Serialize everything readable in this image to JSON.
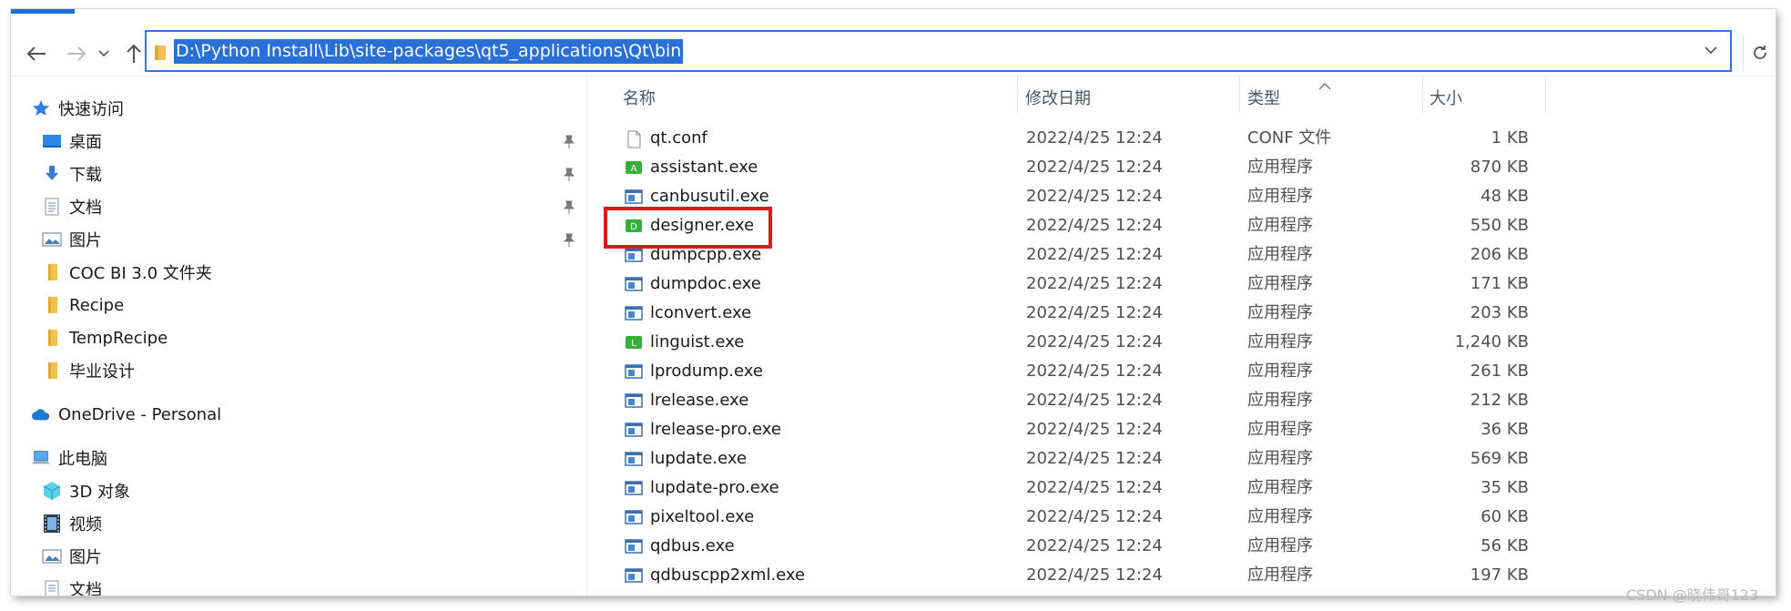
{
  "navbar": {
    "address_path": "D:\\Python Install\\Lib\\site-packages\\qt5_applications\\Qt\\bin",
    "icons": [
      "back-arrow-icon",
      "forward-arrow-icon",
      "recent-dropdown-icon",
      "up-arrow-icon",
      "refresh-icon"
    ]
  },
  "sidebar": {
    "quick_access": "快速访问",
    "pinned": [
      {
        "label": "桌面",
        "icon": "desktop-icon"
      },
      {
        "label": "下载",
        "icon": "download-icon"
      },
      {
        "label": "文档",
        "icon": "documents-icon"
      },
      {
        "label": "图片",
        "icon": "pictures-icon"
      }
    ],
    "folders": [
      {
        "label": "COC BI 3.0 文件夹"
      },
      {
        "label": "Recipe"
      },
      {
        "label": "TempRecipe"
      },
      {
        "label": "毕业设计"
      }
    ],
    "onedrive": "OneDrive - Personal",
    "this_pc": "此电脑",
    "pc_items": [
      {
        "label": "3D 对象",
        "icon": "3d-objects-icon"
      },
      {
        "label": "视频",
        "icon": "videos-icon"
      },
      {
        "label": "图片",
        "icon": "pictures-icon"
      },
      {
        "label": "文档",
        "icon": "documents-icon"
      }
    ]
  },
  "columns": {
    "name": "名称",
    "date": "修改日期",
    "type": "类型",
    "size": "大小"
  },
  "files": [
    {
      "name": "qt.conf",
      "date": "2022/4/25 12:24",
      "type": "CONF 文件",
      "size": "1 KB",
      "icon": "blank-file-icon"
    },
    {
      "name": "assistant.exe",
      "date": "2022/4/25 12:24",
      "type": "应用程序",
      "size": "870 KB",
      "icon": "green-A-app-icon",
      "badge": "A"
    },
    {
      "name": "canbusutil.exe",
      "date": "2022/4/25 12:24",
      "type": "应用程序",
      "size": "48 KB",
      "icon": "exe-app-icon"
    },
    {
      "name": "designer.exe",
      "date": "2022/4/25 12:24",
      "type": "应用程序",
      "size": "550 KB",
      "icon": "green-D-app-icon",
      "badge": "D"
    },
    {
      "name": "dumpcpp.exe",
      "date": "2022/4/25 12:24",
      "type": "应用程序",
      "size": "206 KB",
      "icon": "exe-app-icon"
    },
    {
      "name": "dumpdoc.exe",
      "date": "2022/4/25 12:24",
      "type": "应用程序",
      "size": "171 KB",
      "icon": "exe-app-icon"
    },
    {
      "name": "lconvert.exe",
      "date": "2022/4/25 12:24",
      "type": "应用程序",
      "size": "203 KB",
      "icon": "exe-app-icon"
    },
    {
      "name": "linguist.exe",
      "date": "2022/4/25 12:24",
      "type": "应用程序",
      "size": "1,240 KB",
      "icon": "green-L-app-icon",
      "badge": "L"
    },
    {
      "name": "lprodump.exe",
      "date": "2022/4/25 12:24",
      "type": "应用程序",
      "size": "261 KB",
      "icon": "exe-app-icon"
    },
    {
      "name": "lrelease.exe",
      "date": "2022/4/25 12:24",
      "type": "应用程序",
      "size": "212 KB",
      "icon": "exe-app-icon"
    },
    {
      "name": "lrelease-pro.exe",
      "date": "2022/4/25 12:24",
      "type": "应用程序",
      "size": "36 KB",
      "icon": "exe-app-icon"
    },
    {
      "name": "lupdate.exe",
      "date": "2022/4/25 12:24",
      "type": "应用程序",
      "size": "569 KB",
      "icon": "exe-app-icon"
    },
    {
      "name": "lupdate-pro.exe",
      "date": "2022/4/25 12:24",
      "type": "应用程序",
      "size": "35 KB",
      "icon": "exe-app-icon"
    },
    {
      "name": "pixeltool.exe",
      "date": "2022/4/25 12:24",
      "type": "应用程序",
      "size": "60 KB",
      "icon": "exe-app-icon"
    },
    {
      "name": "qdbus.exe",
      "date": "2022/4/25 12:24",
      "type": "应用程序",
      "size": "56 KB",
      "icon": "exe-app-icon"
    },
    {
      "name": "qdbuscpp2xml.exe",
      "date": "2022/4/25 12:24",
      "type": "应用程序",
      "size": "197 KB",
      "icon": "exe-app-icon"
    }
  ],
  "highlighted_file": "designer.exe",
  "watermark": "CSDN @晓伟哥123",
  "colors": {
    "accent": "#2a6fd6",
    "highlight_box": "#e01818",
    "qt_green": "#35b03a"
  }
}
